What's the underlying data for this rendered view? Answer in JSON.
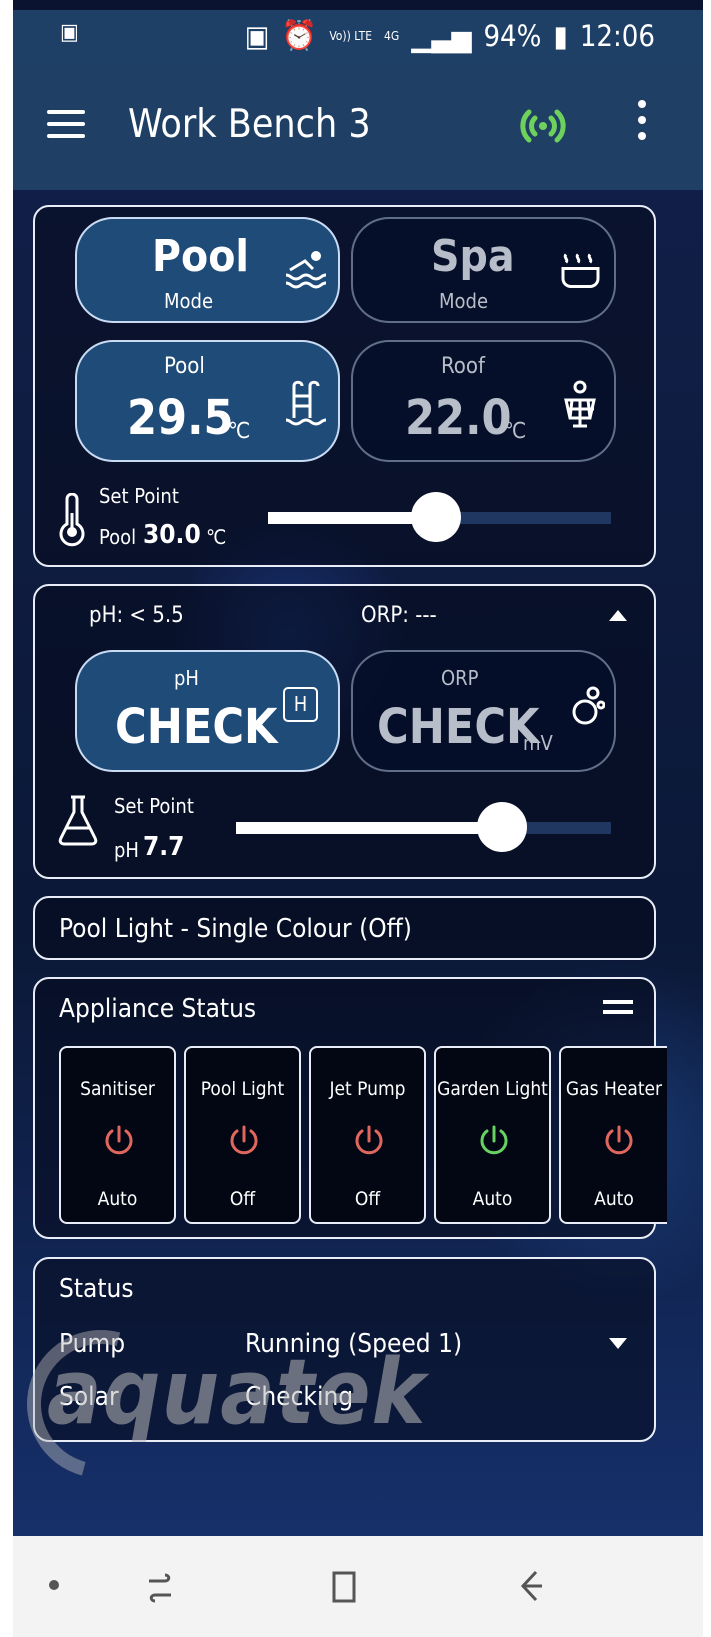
{
  "status_bar": {
    "battery": "94%",
    "time": "12:06",
    "volte": "Vo)) LTE",
    "network": "4G"
  },
  "app_bar": {
    "title": "Work Bench 3"
  },
  "mode": {
    "pool_title": "Pool",
    "pool_subtitle": "Mode",
    "spa_title": "Spa",
    "spa_subtitle": "Mode",
    "pool_temp_label": "Pool",
    "pool_temp": "29.5",
    "pool_unit": "℃",
    "roof_temp_label": "Roof",
    "roof_temp": "22.0",
    "roof_unit": "℃",
    "setpoint_label": "Set Point",
    "setpoint_prefix": "Pool",
    "setpoint_value": "30.0",
    "setpoint_unit": "℃",
    "setpoint_fraction": 0.49
  },
  "chemistry": {
    "ph_status": "pH: < 5.5",
    "orp_status": "ORP: ---",
    "ph_label": "pH",
    "ph_value": "CHECK",
    "ph_badge": "H",
    "orp_label": "ORP",
    "orp_value": "CHECK",
    "orp_unit": "mV",
    "setpoint_label": "Set Point",
    "setpoint_prefix": "pH",
    "setpoint_value": "7.7",
    "setpoint_fraction": 0.71
  },
  "light": {
    "label": "Pool Light - Single Colour (Off)"
  },
  "appliances": {
    "title": "Appliance Status",
    "items": [
      {
        "name": "Sanitiser",
        "status": "Auto",
        "color": "#e0675d"
      },
      {
        "name": "Pool Light",
        "status": "Off",
        "color": "#e0675d"
      },
      {
        "name": "Jet Pump",
        "status": "Off",
        "color": "#e0675d"
      },
      {
        "name": "Garden Light",
        "status": "Auto",
        "color": "#67d162"
      },
      {
        "name": "Gas Heater",
        "status": "Auto",
        "color": "#e0675d"
      }
    ]
  },
  "system_status": {
    "title": "Status",
    "pump_label": "Pump",
    "pump_value": "Running (Speed 1)",
    "solar_label": "Solar",
    "solar_value": "Checking"
  },
  "watermark": {
    "text": "aquatek"
  }
}
